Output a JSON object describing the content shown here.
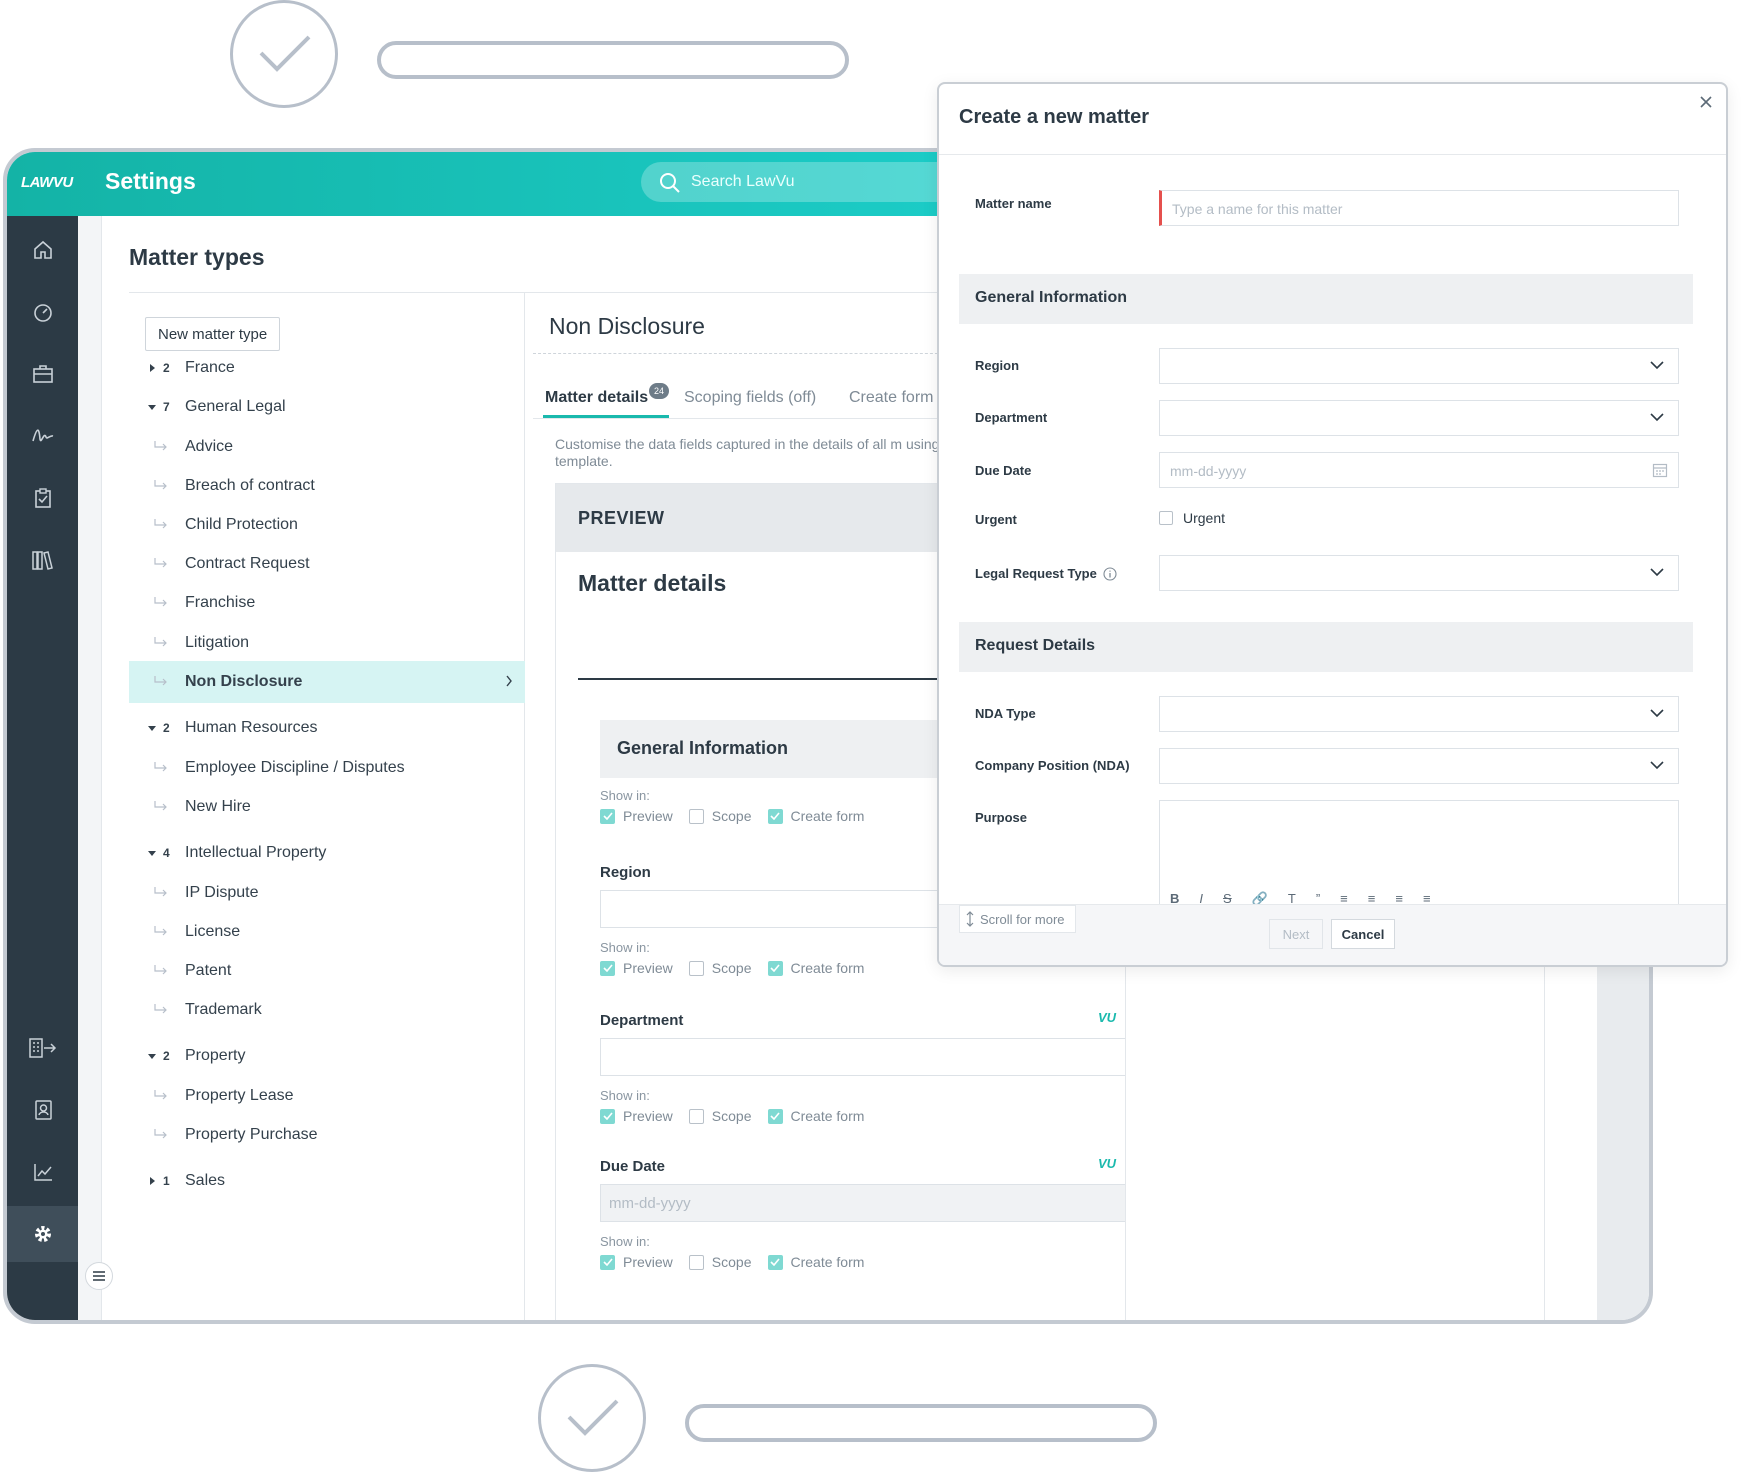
{
  "app": {
    "logo": "LAWVU",
    "title": "Settings",
    "search_placeholder": "Search LawVu",
    "accent": "#1ab9ad",
    "rail_color": "#2c3a45"
  },
  "rail": {
    "top_icons": [
      "home-icon",
      "dashboard-icon",
      "briefcase-icon",
      "signature-icon",
      "clipboard-check-icon",
      "library-icon"
    ],
    "bottom_icons": [
      "building-exit-icon",
      "contacts-icon",
      "chart-icon",
      "settings-gear-icon"
    ]
  },
  "page": {
    "title": "Matter types",
    "new_button": "New matter type"
  },
  "tree": [
    {
      "type": "group",
      "count": "2",
      "label": "France",
      "expanded": false
    },
    {
      "type": "group",
      "count": "7",
      "label": "General Legal",
      "expanded": true
    },
    {
      "type": "child",
      "label": "Advice"
    },
    {
      "type": "child",
      "label": "Breach of contract"
    },
    {
      "type": "child",
      "label": "Child Protection"
    },
    {
      "type": "child",
      "label": "Contract Request"
    },
    {
      "type": "child",
      "label": "Franchise"
    },
    {
      "type": "child",
      "label": "Litigation"
    },
    {
      "type": "child",
      "label": "Non Disclosure",
      "selected": true
    },
    {
      "type": "group",
      "count": "2",
      "label": "Human Resources",
      "expanded": true
    },
    {
      "type": "child",
      "label": "Employee Discipline / Disputes"
    },
    {
      "type": "child",
      "label": "New Hire"
    },
    {
      "type": "group",
      "count": "4",
      "label": "Intellectual Property",
      "expanded": true
    },
    {
      "type": "child",
      "label": "IP Dispute"
    },
    {
      "type": "child",
      "label": "License"
    },
    {
      "type": "child",
      "label": "Patent"
    },
    {
      "type": "child",
      "label": "Trademark"
    },
    {
      "type": "group",
      "count": "2",
      "label": "Property",
      "expanded": true
    },
    {
      "type": "child",
      "label": "Property Lease"
    },
    {
      "type": "child",
      "label": "Property Purchase"
    },
    {
      "type": "group",
      "count": "1",
      "label": "Sales",
      "expanded": false
    }
  ],
  "detail": {
    "title": "Non Disclosure",
    "tabs": [
      {
        "label": "Matter details",
        "badge": "24"
      },
      {
        "label": "Scoping fields (off)"
      },
      {
        "label": "Create form"
      }
    ],
    "description": "Customise the data fields captured in the details of all m using this template.",
    "preview_label": "PREVIEW",
    "preview_title": "Matter details",
    "section": "General Information",
    "show_in": "Show in:",
    "options": {
      "preview": "Preview",
      "scope": "Scope",
      "create": "Create form"
    },
    "fields": {
      "region": "Region",
      "department": "Department",
      "due_date": "Due Date",
      "date_placeholder": "mm-dd-yyyy"
    }
  },
  "modal": {
    "title": "Create a new matter",
    "matter_name_label": "Matter name",
    "matter_name_placeholder": "Type a name for this matter",
    "section1": "General Information",
    "region": "Region",
    "department": "Department",
    "due_date": "Due Date",
    "due_placeholder": "mm-dd-yyyy",
    "urgent_label": "Urgent",
    "urgent_checkbox": "Urgent",
    "legal_request_type": "Legal Request Type",
    "section2": "Request Details",
    "nda_type": "NDA Type",
    "company_position": "Company Position (NDA)",
    "purpose": "Purpose",
    "rte": [
      "B",
      "I",
      "S",
      "🔗",
      "T",
      "”",
      "≡",
      "≡",
      "≡",
      "≡"
    ],
    "scroll_more": "Scroll for more",
    "next": "Next",
    "cancel": "Cancel"
  }
}
